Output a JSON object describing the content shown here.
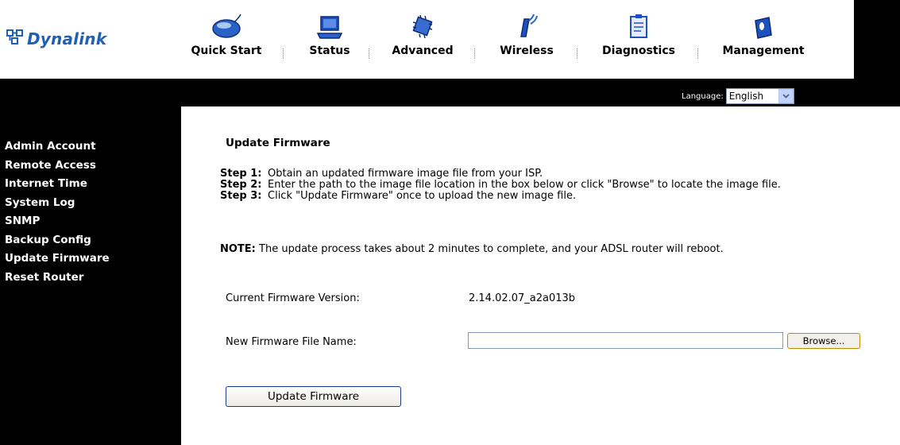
{
  "brand": {
    "logo_text": "Dynalink"
  },
  "nav": {
    "items": [
      {
        "label": "Quick Start",
        "icon": "mouse-icon"
      },
      {
        "label": "Status",
        "icon": "laptop-icon"
      },
      {
        "label": "Advanced",
        "icon": "chip-icon"
      },
      {
        "label": "Wireless",
        "icon": "wireless-icon"
      },
      {
        "label": "Diagnostics",
        "icon": "clipboard-icon"
      },
      {
        "label": "Management",
        "icon": "management-icon"
      }
    ]
  },
  "language": {
    "label": "Language:",
    "selected": "English"
  },
  "sidebar": {
    "items": [
      {
        "label": "Admin Account"
      },
      {
        "label": "Remote Access"
      },
      {
        "label": "Internet Time"
      },
      {
        "label": "System Log"
      },
      {
        "label": "SNMP"
      },
      {
        "label": "Backup Config"
      },
      {
        "label": "Update Firmware"
      },
      {
        "label": "Reset Router"
      }
    ]
  },
  "page": {
    "title": "Update Firmware",
    "steps": [
      {
        "label": "Step 1:",
        "text": "Obtain an updated firmware image file from your ISP."
      },
      {
        "label": "Step 2:",
        "text": "Enter the path to the image file location in the box below or click \"Browse\" to locate the image file."
      },
      {
        "label": "Step 3:",
        "text": "Click \"Update Firmware\" once to upload the new image file."
      }
    ],
    "note_label": "NOTE:",
    "note_text": " The update process takes about 2 minutes to complete, and your ADSL router will reboot.",
    "current_version_label": "Current Firmware Version:",
    "current_version_value": "2.14.02.07_a2a013b",
    "new_file_label": "New Firmware File Name:",
    "new_file_value": "",
    "browse_label": "Browse...",
    "update_button_label": "Update Firmware"
  },
  "colors": {
    "frame": "#000000",
    "logo": "#1f5fb8",
    "browse_border": "#c28a00",
    "update_border": "#1b3c8a"
  }
}
